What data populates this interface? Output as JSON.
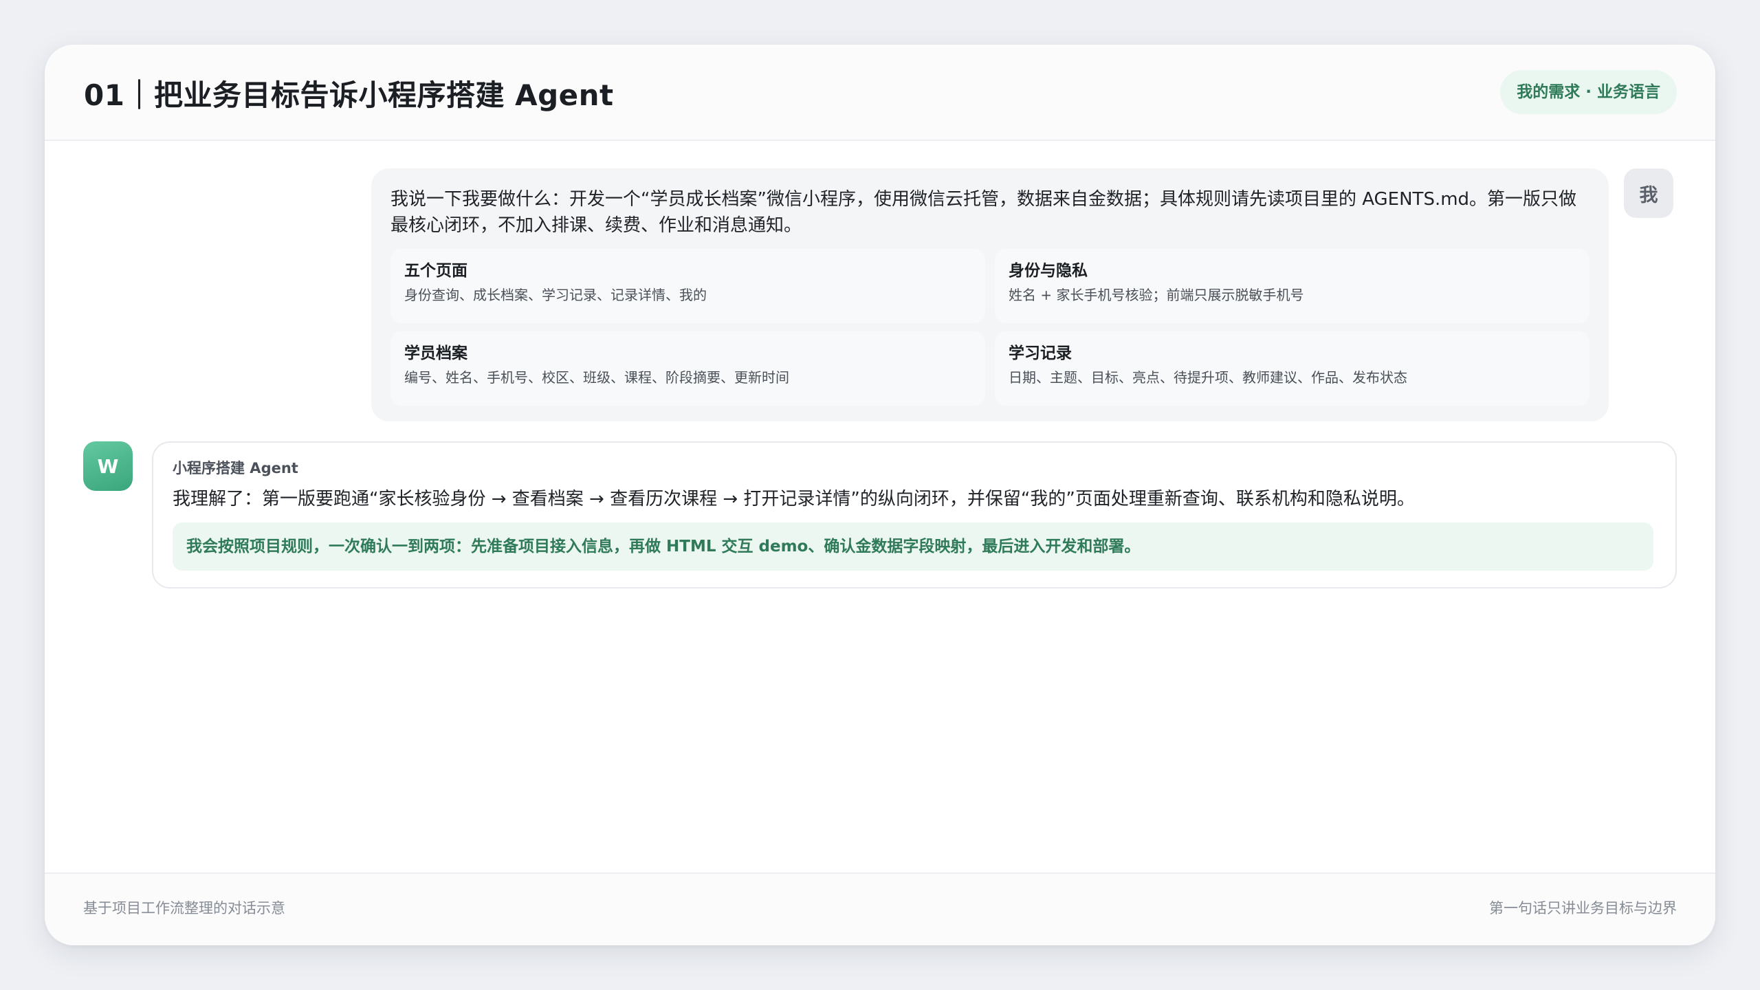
{
  "header": {
    "title": "01｜把业务目标告诉小程序搭建 Agent",
    "badge": "我的需求 · 业务语言"
  },
  "user_message": {
    "avatar_label": "我",
    "text": "我说一下我要做什么：开发一个“学员成长档案”微信小程序，使用微信云托管，数据来自金数据；具体规则请先读项目里的 AGENTS.md。第一版只做最核心闭环，不加入排课、续费、作业和消息通知。",
    "requirements": [
      {
        "title": "五个页面",
        "desc": "身份查询、成长档案、学习记录、记录详情、我的"
      },
      {
        "title": "身份与隐私",
        "desc": "姓名 + 家长手机号核验；前端只展示脱敏手机号"
      },
      {
        "title": "学员档案",
        "desc": "编号、姓名、手机号、校区、班级、课程、阶段摘要、更新时间"
      },
      {
        "title": "学习记录",
        "desc": "日期、主题、目标、亮点、待提升项、教师建议、作品、发布状态"
      }
    ]
  },
  "agent_message": {
    "avatar_label": "W",
    "name": "小程序搭建 Agent",
    "text": "我理解了：第一版要跑通“家长核验身份 → 查看档案 → 查看历次课程 → 打开记录详情”的纵向闭环，并保留“我的”页面处理重新查询、联系机构和隐私说明。",
    "callout": "我会按照项目规则，一次确认一到两项：先准备项目接入信息，再做 HTML 交互 demo、确认金数据字段映射，最后进入开发和部署。"
  },
  "footer": {
    "left": "基于项目工作流整理的对话示意",
    "right": "第一句话只讲业务目标与边界"
  },
  "colors": {
    "accent_green": "#2f7a58",
    "callout_bg": "#ecf7f1",
    "agent_avatar": "#3aa57b"
  }
}
